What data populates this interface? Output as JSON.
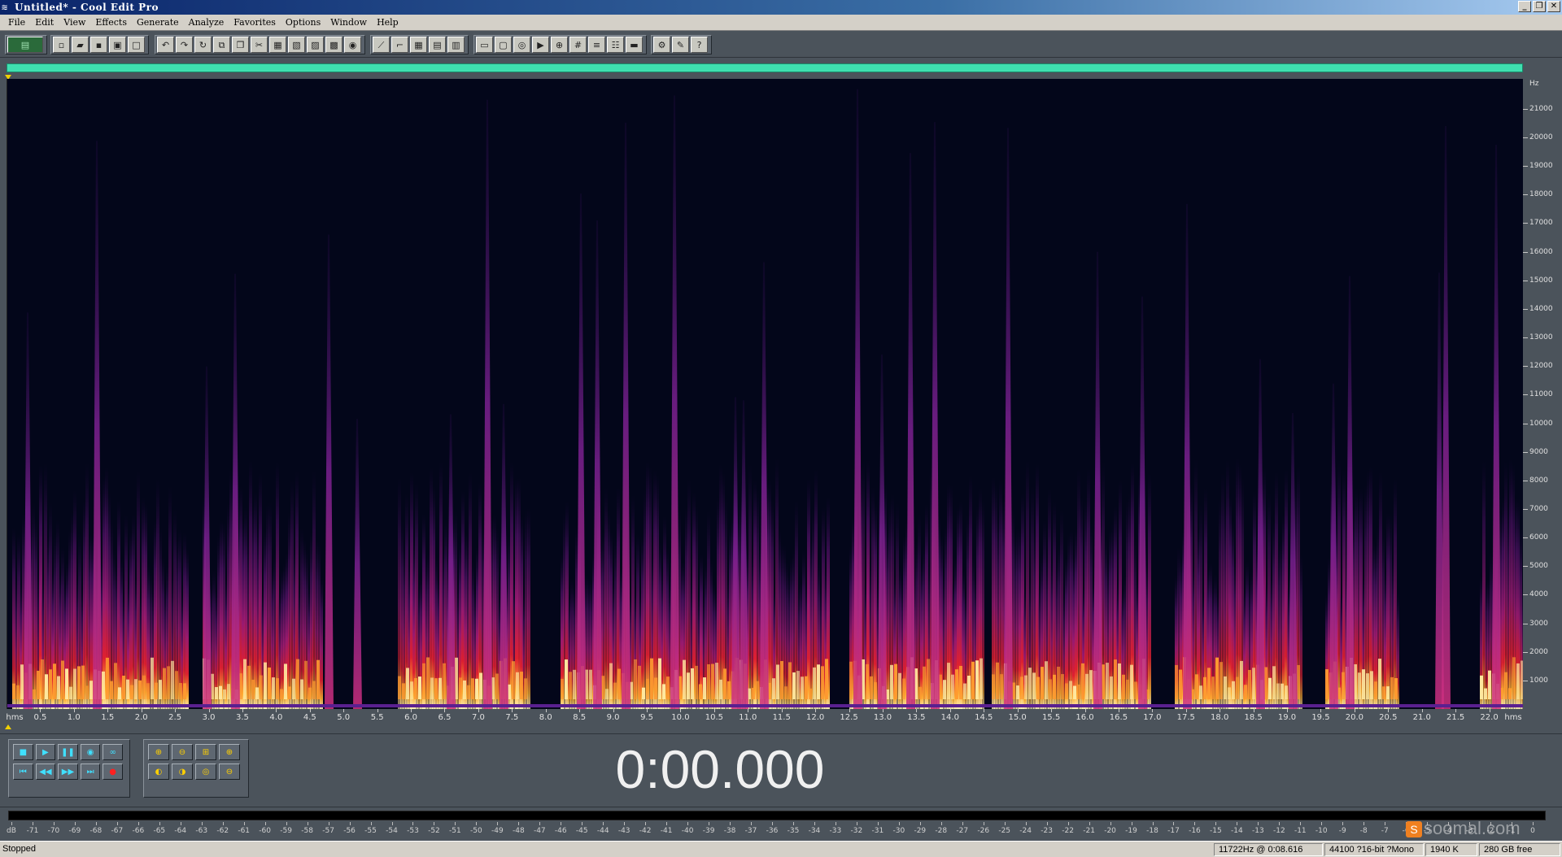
{
  "window": {
    "title": "Untitled* - Cool Edit Pro",
    "controls": [
      "_",
      "❐",
      "✕"
    ]
  },
  "menu": [
    "File",
    "Edit",
    "View",
    "Effects",
    "Generate",
    "Analyze",
    "Favorites",
    "Options",
    "Window",
    "Help"
  ],
  "spectrogram": {
    "freq_unit": "Hz",
    "freq_labels": [
      "21000",
      "20000",
      "19000",
      "18000",
      "17000",
      "16000",
      "15000",
      "14000",
      "13000",
      "12000",
      "11000",
      "10000",
      "9000",
      "8000",
      "7000",
      "6000",
      "5000",
      "4000",
      "3000",
      "2000",
      "1000"
    ],
    "time_unit_left": "hms",
    "time_unit_right": "hms",
    "time_labels": [
      "0.5",
      "1.0",
      "1.5",
      "2.0",
      "2.5",
      "3.0",
      "3.5",
      "4.0",
      "4.5",
      "5.0",
      "5.5",
      "6.0",
      "6.5",
      "7.0",
      "7.5",
      "8.0",
      "8.5",
      "9.0",
      "9.5",
      "10.0",
      "10.5",
      "11.0",
      "11.5",
      "12.0",
      "12.5",
      "13.0",
      "13.5",
      "14.0",
      "14.5",
      "15.0",
      "15.5",
      "16.0",
      "16.5",
      "17.0",
      "17.5",
      "18.0",
      "18.5",
      "19.0",
      "19.5",
      "20.0",
      "20.5",
      "21.0",
      "21.5",
      "22.0"
    ],
    "duration_seconds": 22.5,
    "freq_max_hz": 22050,
    "colors": {
      "background": "#03061a",
      "low": "#5a1070",
      "mid": "#c01830",
      "high": "#ff9a20",
      "peak": "#fff0b0"
    }
  },
  "transport": {
    "row1": [
      "stop-icon",
      "play-icon",
      "pause-icon",
      "play-to-end-icon",
      "loop-icon"
    ],
    "row2": [
      "go-to-start-icon",
      "rewind-icon",
      "fast-forward-icon",
      "go-to-end-icon",
      "record-icon"
    ]
  },
  "zoom": {
    "row1": [
      "zoom-in-horizontal-icon",
      "zoom-out-horizontal-icon",
      "zoom-full-icon",
      "zoom-in-vertical-icon"
    ],
    "row2": [
      "zoom-to-left-icon",
      "zoom-to-right-icon",
      "zoom-selection-icon",
      "zoom-out-vertical-icon"
    ]
  },
  "time_display": "0:00.000",
  "meter": {
    "db_labels": [
      "dB",
      "-71",
      "-70",
      "-69",
      "-68",
      "-67",
      "-66",
      "-65",
      "-64",
      "-63",
      "-62",
      "-61",
      "-60",
      "-59",
      "-58",
      "-57",
      "-56",
      "-55",
      "-54",
      "-53",
      "-52",
      "-51",
      "-50",
      "-49",
      "-48",
      "-47",
      "-46",
      "-45",
      "-44",
      "-43",
      "-42",
      "-41",
      "-40",
      "-39",
      "-38",
      "-37",
      "-36",
      "-35",
      "-34",
      "-33",
      "-32",
      "-31",
      "-30",
      "-29",
      "-28",
      "-27",
      "-26",
      "-25",
      "-24",
      "-23",
      "-22",
      "-21",
      "-20",
      "-19",
      "-18",
      "-17",
      "-16",
      "-15",
      "-14",
      "-13",
      "-12",
      "-11",
      "-10",
      "-9",
      "-8",
      "-7",
      "-6",
      "-5",
      "-4",
      "-3",
      "-2",
      "-1",
      "0"
    ]
  },
  "status": {
    "state": "Stopped",
    "cursor": "11722Hz @  0:08.616",
    "format": "44100 ?16-bit ?Mono",
    "size": "1940 K",
    "free": "280 GB free"
  },
  "watermark": {
    "badge": "S",
    "text": "soomal.com"
  }
}
